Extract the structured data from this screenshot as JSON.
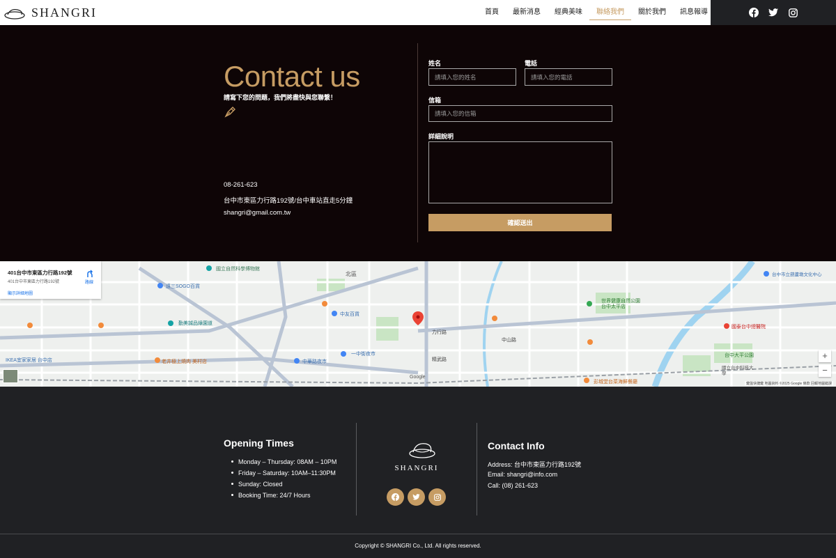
{
  "header": {
    "logo_text": "SHANGRI",
    "nav": [
      {
        "label": "首頁"
      },
      {
        "label": "最新消息"
      },
      {
        "label": "經典美味"
      },
      {
        "label": "聯絡我們",
        "active": true
      },
      {
        "label": "關於我們"
      },
      {
        "label": "訊息報導"
      }
    ],
    "social_icons": [
      "facebook-icon",
      "twitter-icon",
      "instagram-icon"
    ]
  },
  "contact": {
    "title": "Contact us",
    "subtitle": "請寫下您的問題，我們將盡快與您聯繫！",
    "phone": "08-261-623",
    "address": "台中市東區力行路192號/台中車站直走5分鐘",
    "email": "shangri@gmail.com.tw",
    "form": {
      "name_label": "姓名",
      "name_placeholder": "請填入您的姓名",
      "phone_label": "電話",
      "phone_placeholder": "請填入您的電話",
      "email_label": "信箱",
      "email_placeholder": "請填入您的信箱",
      "detail_label": "詳細說明",
      "submit_label": "確認送出"
    }
  },
  "map": {
    "card_title": "401台中市東區力行路192號",
    "card_address": "401台中市東區力行路192號",
    "card_link": "顯示詳細地圖",
    "directions_label": "路線",
    "brand": "Google",
    "footer_text": "鍵盤快捷鍵 地圖資料 ©2025 Google 條款 回報地圖錯誤",
    "labels": [
      {
        "text": "國立自然科學博物館"
      },
      {
        "text": "北區"
      },
      {
        "text": "台中市立葫蘆墩文化中心"
      },
      {
        "text": "遠三SOGO百貨"
      },
      {
        "text": "中友百貨"
      },
      {
        "text": "世界健康自然公園 台中太平店"
      },
      {
        "text": "一中街夜市"
      },
      {
        "text": "勤美誠品綠園道"
      },
      {
        "text": "中華路夜市"
      },
      {
        "text": "IKEA宜家家居 台中店"
      },
      {
        "text": "老井極上燒肉 美村店"
      },
      {
        "text": "國立台中科技大學"
      },
      {
        "text": "彭城堂台菜海鮮餐廳"
      },
      {
        "text": "力行路"
      },
      {
        "text": "精武路"
      },
      {
        "text": "中山路"
      },
      {
        "text": "國泰台中總醫院"
      },
      {
        "text": "台中大平公園"
      }
    ]
  },
  "footer": {
    "opening_title": "Opening Times",
    "hours": [
      "Monday – Thursday: 08AM – 10PM",
      "Friday – Saturday: 10AM–11:30PM",
      "Sunday: Closed",
      "Booking Time: 24/7 Hours"
    ],
    "logo_text": "SHANGRI",
    "contact_title": "Contact Info",
    "address": "Address: 台中市東區力行路192號",
    "email": "Email: shangri@info.com",
    "call": "Call: (08) 261-623",
    "copyright": "Copyright © SHANGRI Co., Ltd. All rights reserved."
  },
  "colors": {
    "accent": "#c69c63",
    "dark_bg": "#0e0506",
    "footer_bg": "#202124"
  }
}
